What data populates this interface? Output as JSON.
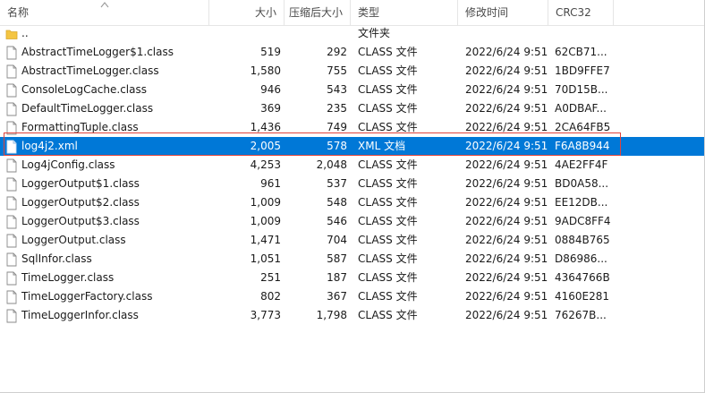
{
  "columns": {
    "name": "名称",
    "size": "大小",
    "packed": "压缩后大小",
    "type": "类型",
    "modified": "修改时间",
    "crc": "CRC32"
  },
  "sort_indicator": "sort-ascending-icon",
  "files": [
    {
      "name": "..",
      "size": "",
      "packed": "",
      "type": "文件夹",
      "modified": "",
      "crc": "",
      "icon": "folder-icon"
    },
    {
      "name": "AbstractTimeLogger$1.class",
      "size": "519",
      "packed": "292",
      "type": "CLASS 文件",
      "modified": "2022/6/24 9:51",
      "crc": "62CB71...",
      "icon": "file-icon"
    },
    {
      "name": "AbstractTimeLogger.class",
      "size": "1,580",
      "packed": "755",
      "type": "CLASS 文件",
      "modified": "2022/6/24 9:51",
      "crc": "1BD9FFE7",
      "icon": "file-icon"
    },
    {
      "name": "ConsoleLogCache.class",
      "size": "946",
      "packed": "543",
      "type": "CLASS 文件",
      "modified": "2022/6/24 9:51",
      "crc": "70D15B...",
      "icon": "file-icon"
    },
    {
      "name": "DefaultTimeLogger.class",
      "size": "369",
      "packed": "235",
      "type": "CLASS 文件",
      "modified": "2022/6/24 9:51",
      "crc": "A0DBAF...",
      "icon": "file-icon"
    },
    {
      "name": "FormattingTuple.class",
      "size": "1,436",
      "packed": "749",
      "type": "CLASS 文件",
      "modified": "2022/6/24 9:51",
      "crc": "2CA64FB5",
      "icon": "file-icon"
    },
    {
      "name": "log4j2.xml",
      "size": "2,005",
      "packed": "578",
      "type": "XML 文档",
      "modified": "2022/6/24 9:51",
      "crc": "F6A8B944",
      "icon": "file-icon",
      "selected": true
    },
    {
      "name": "Log4jConfig.class",
      "size": "4,253",
      "packed": "2,048",
      "type": "CLASS 文件",
      "modified": "2022/6/24 9:51",
      "crc": "4AE2FF4F",
      "icon": "file-icon"
    },
    {
      "name": "LoggerOutput$1.class",
      "size": "961",
      "packed": "537",
      "type": "CLASS 文件",
      "modified": "2022/6/24 9:51",
      "crc": "BD0A58...",
      "icon": "file-icon"
    },
    {
      "name": "LoggerOutput$2.class",
      "size": "1,009",
      "packed": "548",
      "type": "CLASS 文件",
      "modified": "2022/6/24 9:51",
      "crc": "EE12DB...",
      "icon": "file-icon"
    },
    {
      "name": "LoggerOutput$3.class",
      "size": "1,009",
      "packed": "546",
      "type": "CLASS 文件",
      "modified": "2022/6/24 9:51",
      "crc": "9ADC8FF4",
      "icon": "file-icon"
    },
    {
      "name": "LoggerOutput.class",
      "size": "1,471",
      "packed": "704",
      "type": "CLASS 文件",
      "modified": "2022/6/24 9:51",
      "crc": "0884B765",
      "icon": "file-icon"
    },
    {
      "name": "SqlInfor.class",
      "size": "1,051",
      "packed": "587",
      "type": "CLASS 文件",
      "modified": "2022/6/24 9:51",
      "crc": "D86986...",
      "icon": "file-icon"
    },
    {
      "name": "TimeLogger.class",
      "size": "251",
      "packed": "187",
      "type": "CLASS 文件",
      "modified": "2022/6/24 9:51",
      "crc": "4364766B",
      "icon": "file-icon"
    },
    {
      "name": "TimeLoggerFactory.class",
      "size": "802",
      "packed": "367",
      "type": "CLASS 文件",
      "modified": "2022/6/24 9:51",
      "crc": "4160E281",
      "icon": "file-icon"
    },
    {
      "name": "TimeLoggerInfor.class",
      "size": "3,773",
      "packed": "1,798",
      "type": "CLASS 文件",
      "modified": "2022/6/24 9:51",
      "crc": "76267B...",
      "icon": "file-icon"
    }
  ],
  "colors": {
    "selection": "#0078d7",
    "highlight_border": "#e0443c",
    "folder": "#f4c542"
  }
}
